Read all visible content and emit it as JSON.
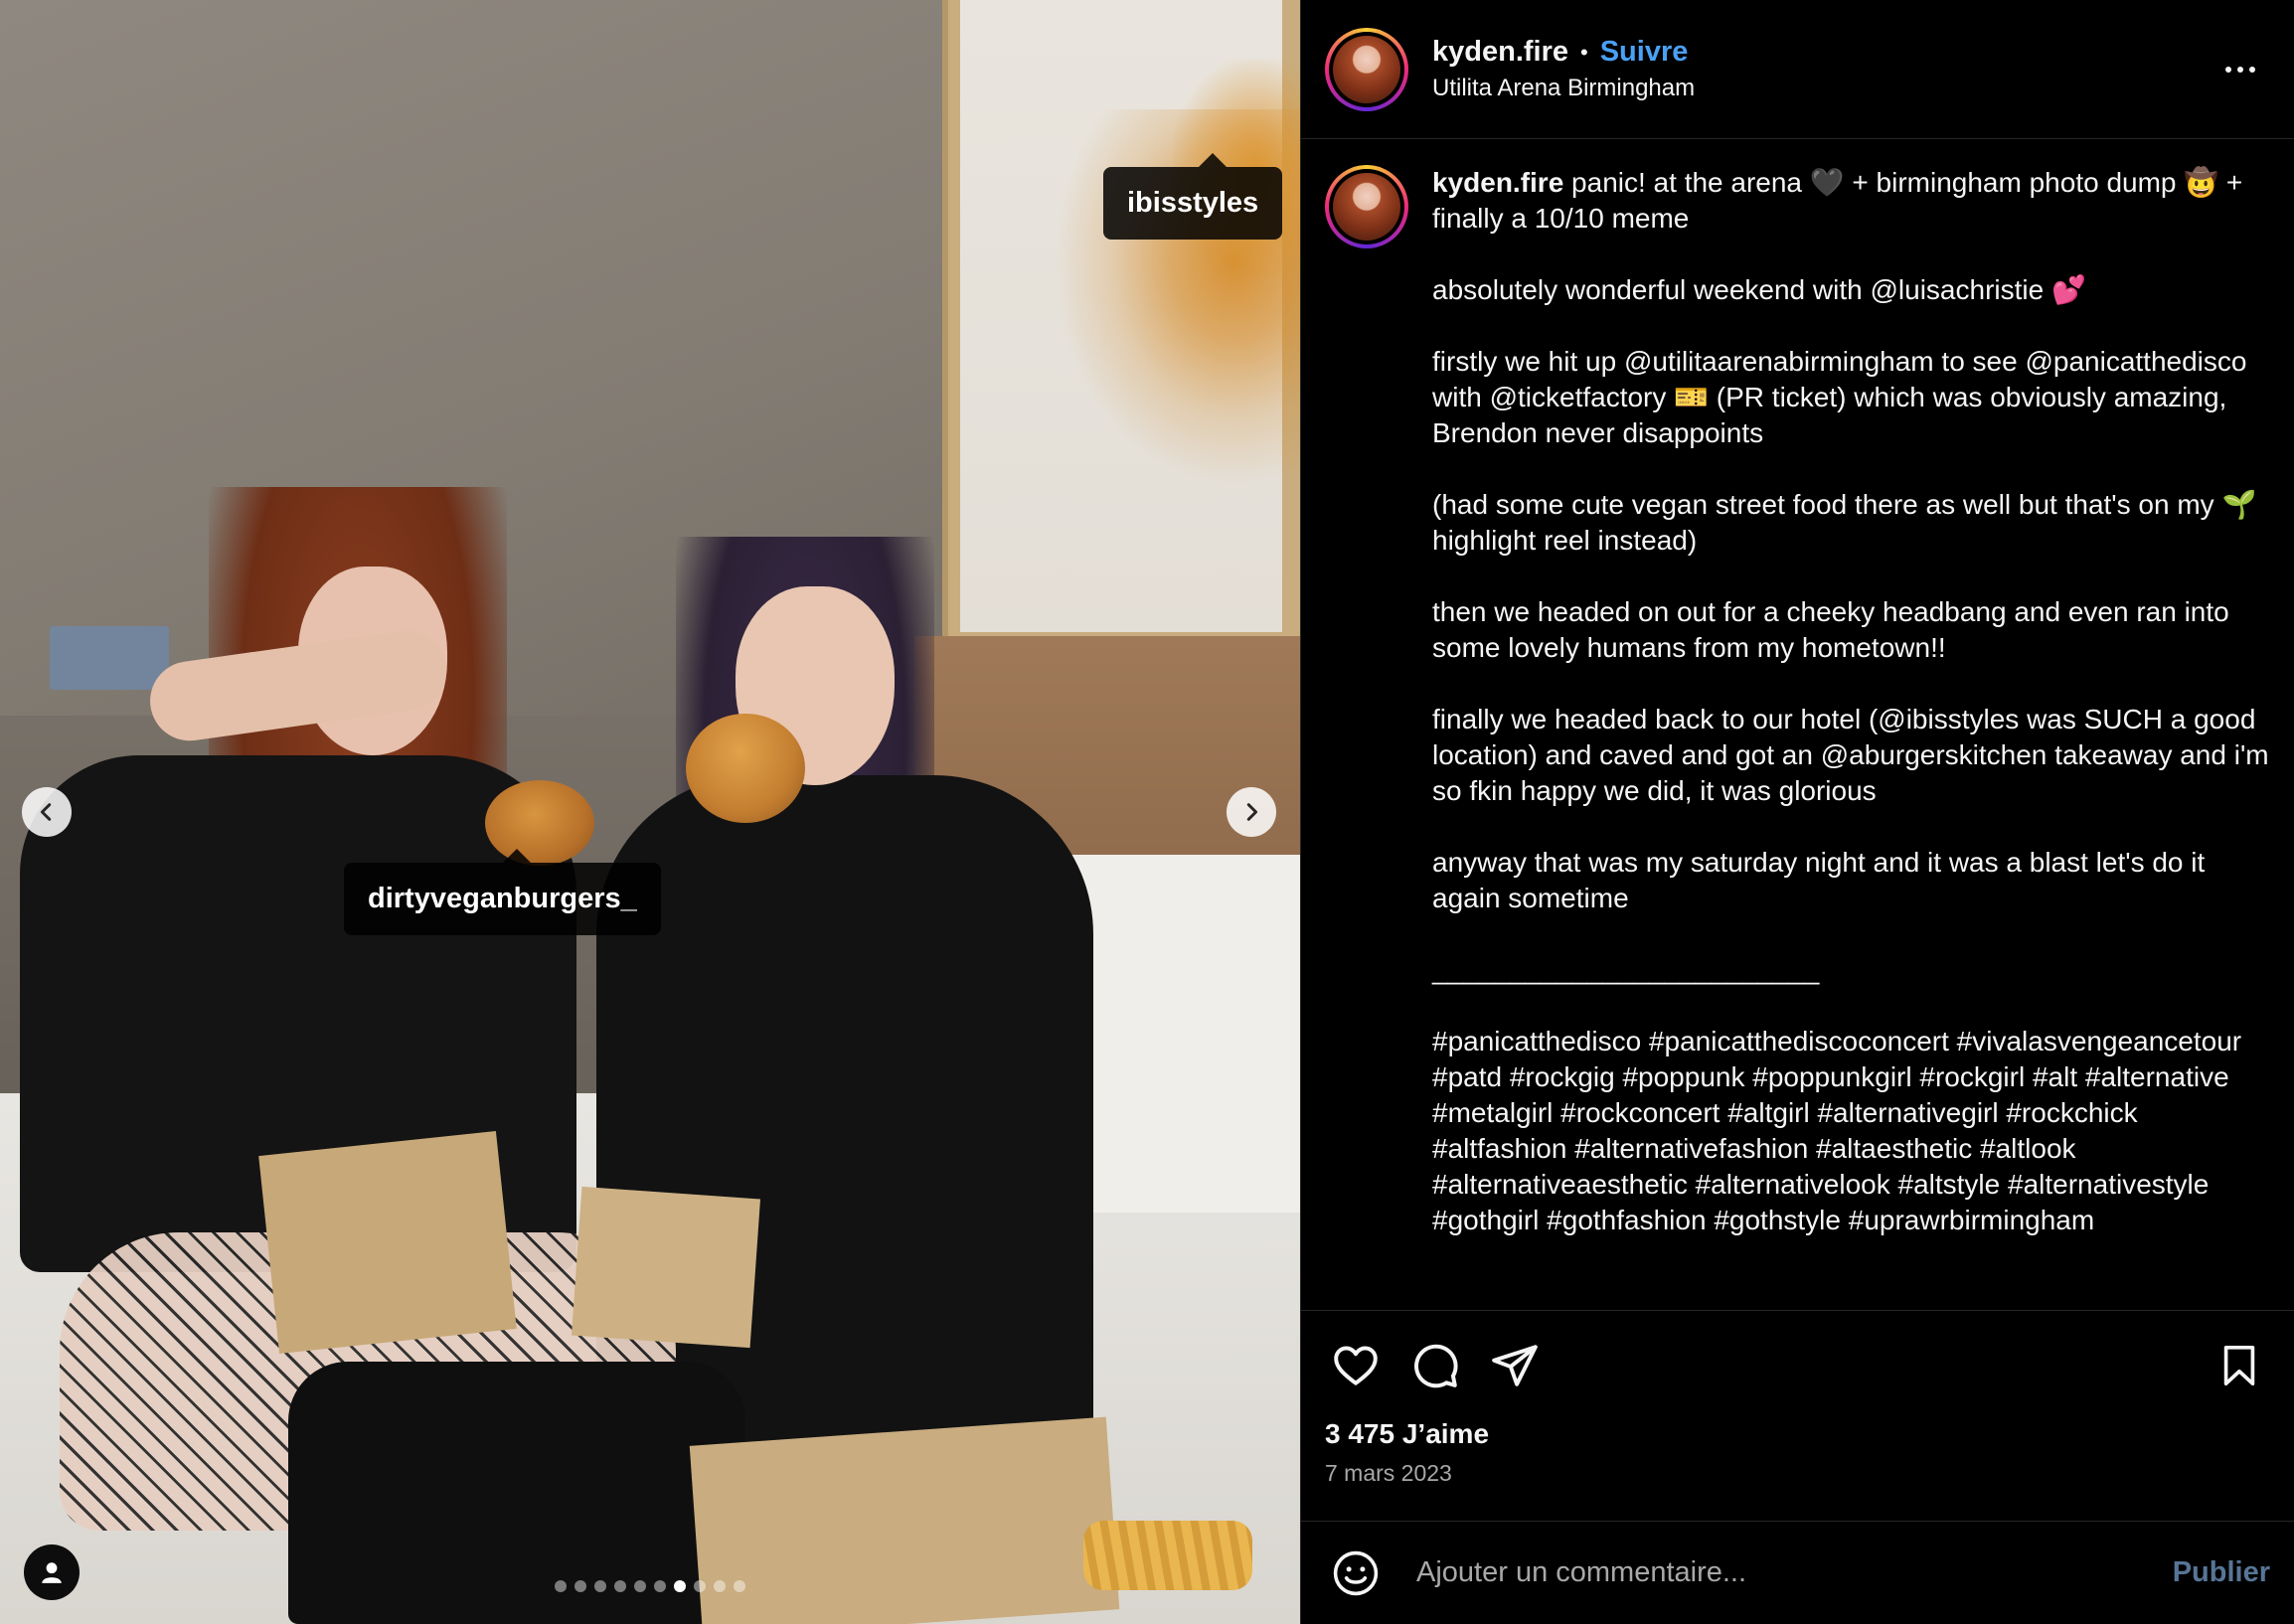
{
  "photo": {
    "tags": {
      "ibis": "ibisstyles",
      "dirty": "dirtyveganburgers_"
    },
    "carousel": {
      "total_dots": 10,
      "active_index": 6
    }
  },
  "header": {
    "username": "kyden.fire",
    "separator": "•",
    "follow_label": "Suivre",
    "location": "Utilita Arena Birmingham"
  },
  "caption": {
    "username": "kyden.fire",
    "text": " panic! at the arena 🖤 + birmingham photo dump 🤠 + finally a 10/10 meme\n\nabsolutely wonderful weekend with @luisachristie 💕\n\nfirstly we hit up @utilitaarenabirmingham to see @panicatthedisco with @ticketfactory 🎫 (PR ticket) which was obviously amazing, Brendon never disappoints\n\n(had some cute vegan street food there as well but that's on my 🌱 highlight reel instead)\n\nthen we headed on out for a cheeky headbang and even ran into some lovely humans from my hometown!!\n\nfinally we headed back to our hotel (@ibisstyles was SUCH a good location) and caved and got an @aburgerskitchen takeaway and i'm so fkin happy we did, it was glorious\n\nanyway that was my saturday night and it was a blast let's do it again sometime\n\n_________________________\n\n#panicatthedisco #panicatthediscoconcert #vivalasvengeancetour #patd #rockgig #poppunk #poppunkgirl #rockgirl #alt #alternative #metalgirl #rockconcert #altgirl #alternativegirl #rockchick #altfashion #alternativefashion #altaesthetic #altlook #alternativeaesthetic #alternativelook #altstyle #alternativestyle #gothgirl #gothfashion #gothstyle #uprawrbirmingham"
  },
  "actions": {
    "likes": "3 475 J’aime",
    "date": "7 mars 2023"
  },
  "comment": {
    "placeholder": "Ajouter un commentaire...",
    "publish_label": "Publier"
  },
  "icons": {
    "like": "heart-icon",
    "comment": "comment-icon",
    "share": "share-icon",
    "save": "bookmark-icon",
    "emoji": "emoji-icon",
    "more": "more-icon",
    "user": "user-icon",
    "prev": "chevron-left-icon",
    "next": "chevron-right-icon"
  },
  "colors": {
    "background": "#000000",
    "text": "#f5f5f5",
    "follow": "#4aa0f5",
    "muted": "#a8a8a8"
  }
}
